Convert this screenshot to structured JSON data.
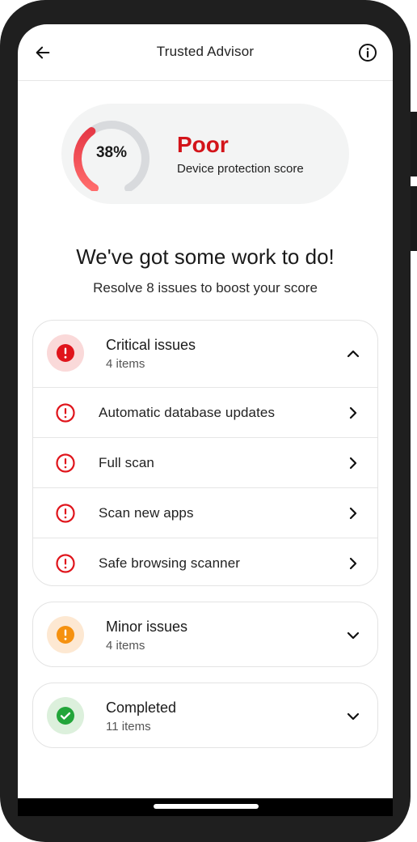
{
  "appbar": {
    "title": "Trusted Advisor",
    "back_icon": "arrow-left-icon",
    "info_icon": "info-icon"
  },
  "score": {
    "percent_text": "38%",
    "percent_value": 38,
    "rating": "Poor",
    "subtitle": "Device protection score",
    "colors": {
      "rating": "#d3141a",
      "arc_start": "#ff6b6b",
      "arc_end": "#e63946",
      "track": "#d8dadd"
    }
  },
  "intro": {
    "heading": "We've got some work to do!",
    "subheading": "Resolve 8 issues to boost your score"
  },
  "groups": [
    {
      "title": "Critical issues",
      "count": "4 items",
      "icon": "alert-circle-icon",
      "color": "#e0141b",
      "expanded": true,
      "items": [
        {
          "label": "Automatic database updates"
        },
        {
          "label": "Full scan"
        },
        {
          "label": "Scan new apps"
        },
        {
          "label": "Safe browsing scanner"
        }
      ]
    },
    {
      "title": "Minor issues",
      "count": "4 items",
      "icon": "alert-circle-icon",
      "color": "#f5910f",
      "expanded": false
    },
    {
      "title": "Completed",
      "count": "11 items",
      "icon": "check-circle-icon",
      "color": "#22a53a",
      "expanded": false
    }
  ]
}
